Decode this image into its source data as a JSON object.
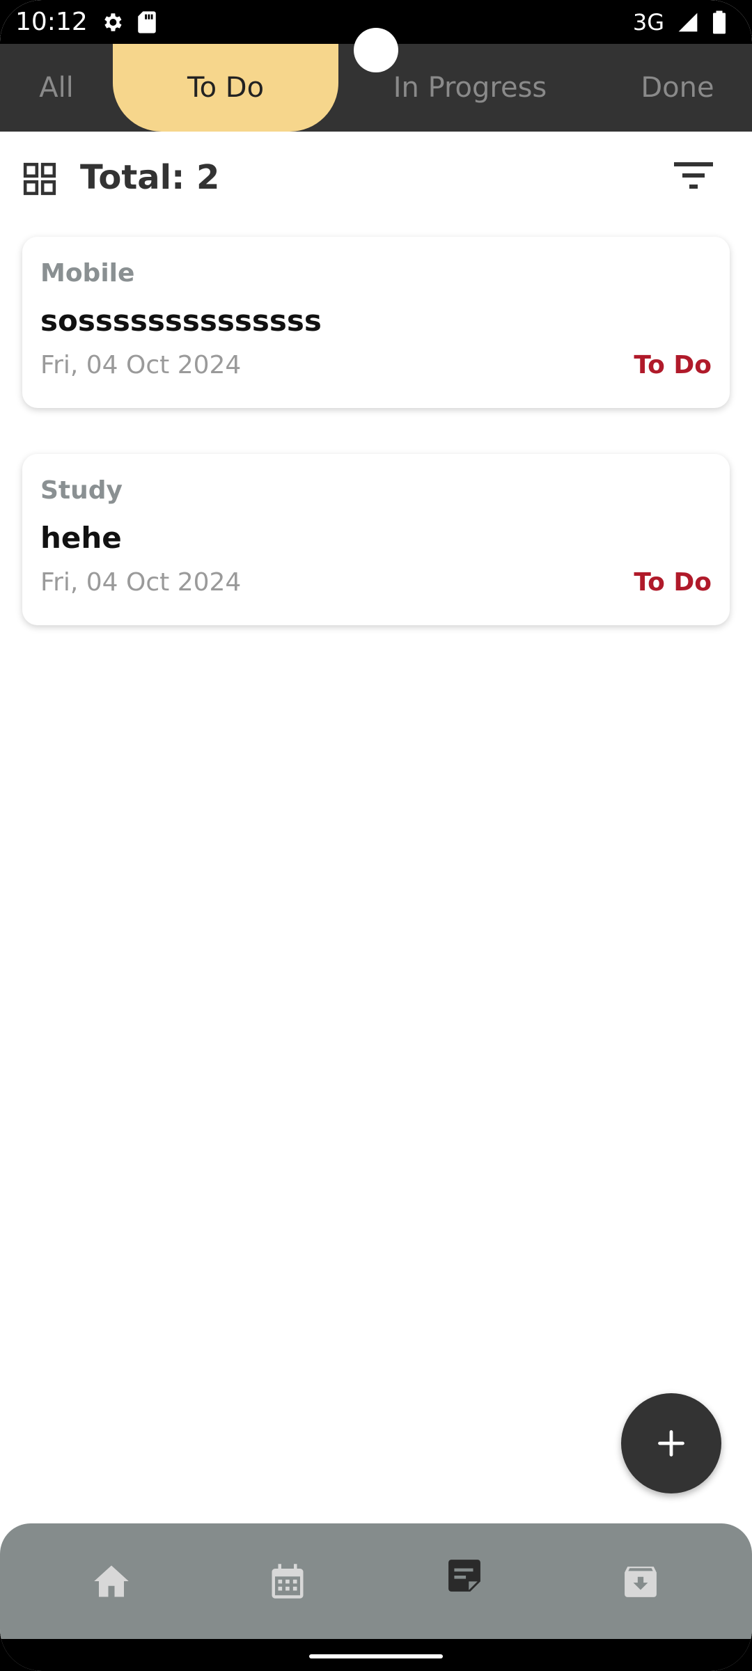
{
  "status_bar": {
    "time": "10:12",
    "network": "3G",
    "icons": [
      "settings-icon",
      "sd-card-icon",
      "signal-icon",
      "battery-icon"
    ]
  },
  "tabs": [
    {
      "label": "All",
      "active": false
    },
    {
      "label": "To Do",
      "active": true
    },
    {
      "label": "In Progress",
      "active": false
    },
    {
      "label": "Done",
      "active": false
    }
  ],
  "list_header": {
    "total_label": "Total: 2"
  },
  "tasks": [
    {
      "category": "Mobile",
      "title": "sossssssssssssss",
      "date": "Fri, 04 Oct 2024",
      "status": "To Do"
    },
    {
      "category": "Study",
      "title": "hehe",
      "date": "Fri, 04 Oct 2024",
      "status": "To Do"
    }
  ],
  "bottom_nav": {
    "items": [
      "home-icon",
      "calendar-icon",
      "notes-icon",
      "archive-icon"
    ],
    "active": "notes-icon"
  },
  "colors": {
    "tab_bar_bg": "#333333",
    "active_tab_bg": "#f6d68c",
    "status_text": "#b01a2a",
    "bottom_nav_bg": "#858c8c",
    "fab_bg": "#333333"
  }
}
